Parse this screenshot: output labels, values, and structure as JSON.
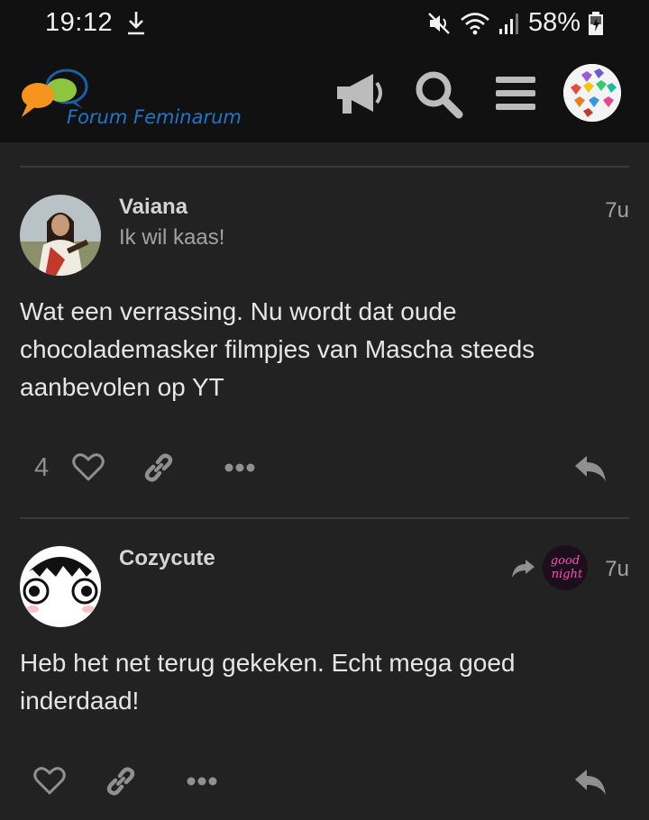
{
  "status_bar": {
    "time": "19:12",
    "battery": "58%",
    "icons": [
      "download-icon",
      "mute-icon",
      "wifi-icon",
      "signal-icon",
      "battery-charging-icon"
    ]
  },
  "header": {
    "site_name": "Forum Feminarum",
    "icons": [
      "megaphone-icon",
      "search-icon",
      "hamburger-menu-icon",
      "user-avatar"
    ]
  },
  "posts": [
    {
      "username": "Vaiana",
      "subtitle": "Ik wil kaas!",
      "age": "7u",
      "body": "Wat een verrassing. Nu wordt dat oude chocolademasker filmpjes van Mascha steeds aanbevolen op YT",
      "like_count": "4",
      "actions": [
        "heart-icon",
        "link-icon",
        "more-icon",
        "reply-icon"
      ]
    },
    {
      "username": "Cozycute",
      "age": "7u",
      "reply_to_avatar_text": "good night",
      "body": "Heb het net terug gekeken. Echt mega goed inderdaad!",
      "actions": [
        "heart-icon",
        "link-icon",
        "more-icon",
        "reply-icon"
      ]
    }
  ],
  "colors": {
    "background": "#222222",
    "header": "#111111",
    "brand_blue": "#1e76c8",
    "text": "#e6e6e6",
    "muted": "#a3a3a3"
  }
}
